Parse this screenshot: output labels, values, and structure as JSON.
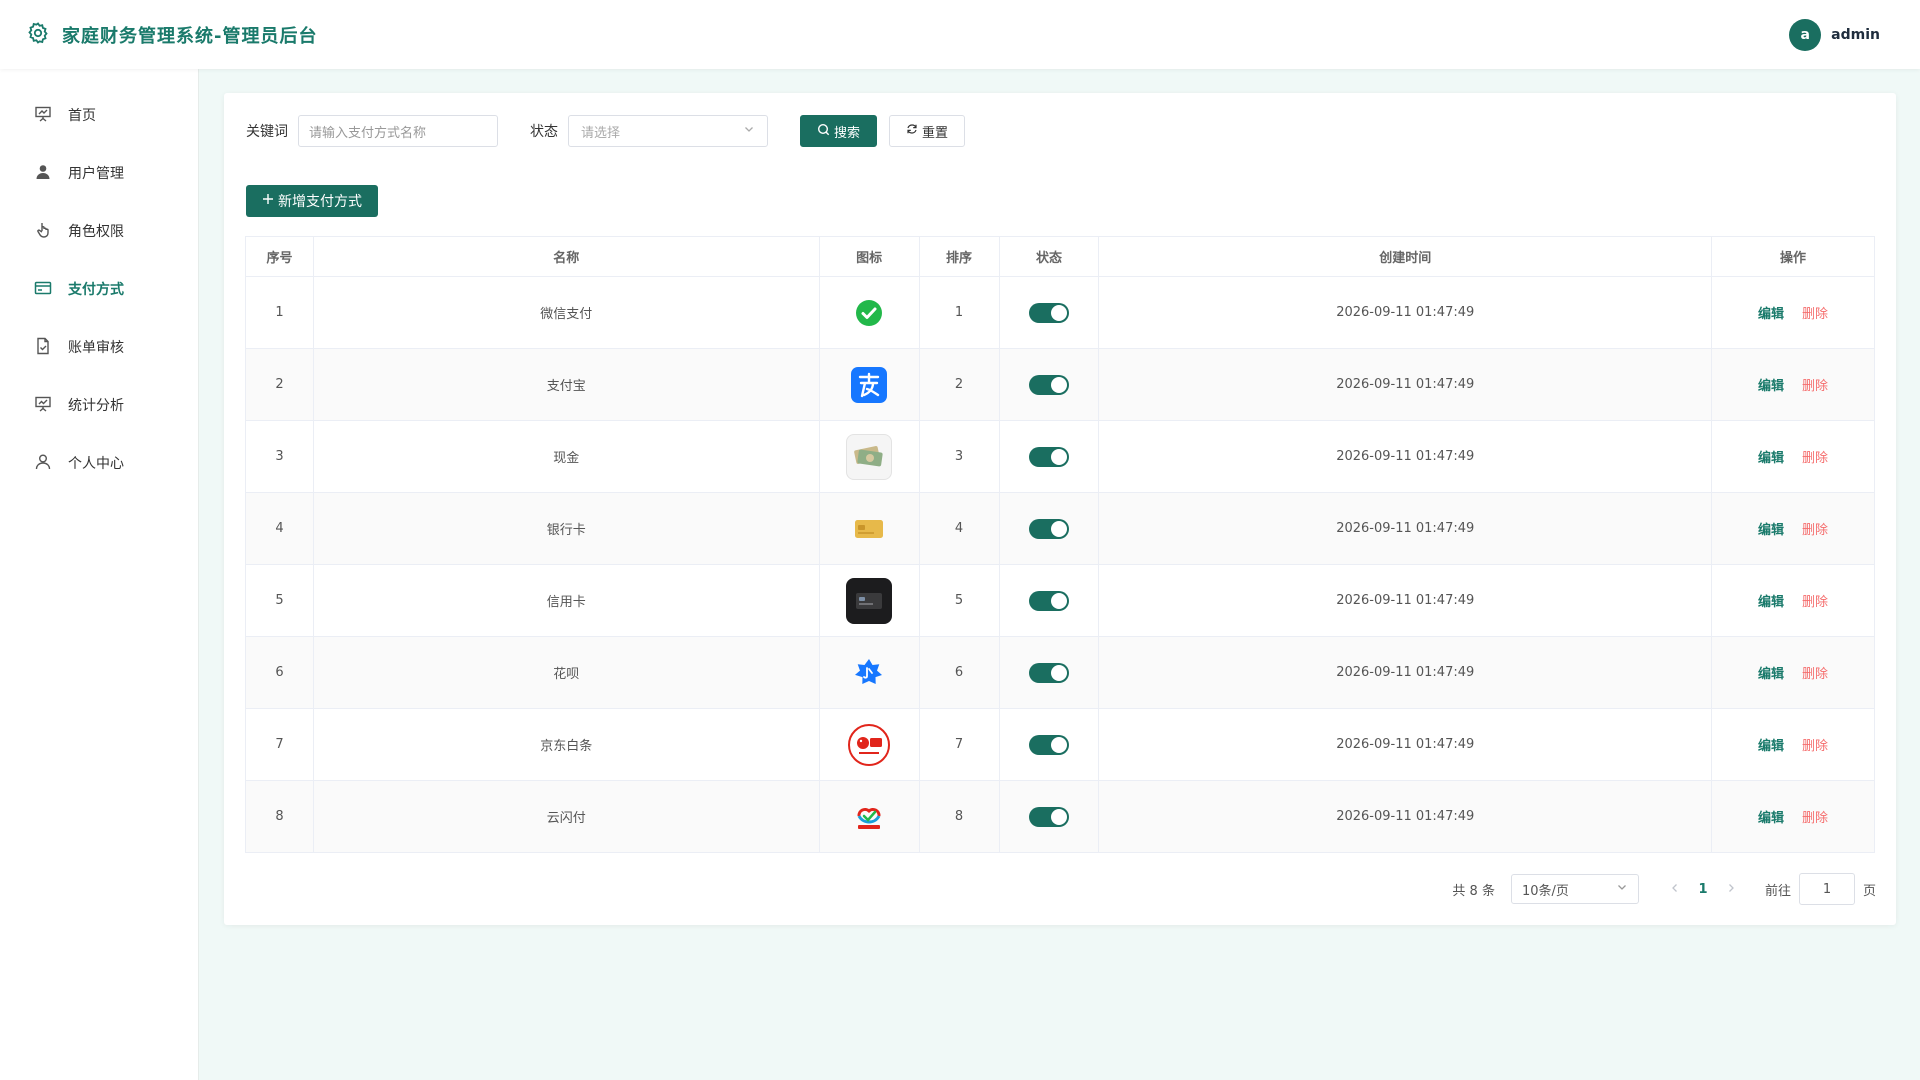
{
  "header": {
    "title": "家庭财务管理系统-管理员后台",
    "user_initial": "a",
    "username": "admin"
  },
  "sidebar": {
    "items": [
      {
        "label": "首页",
        "icon": "presentation-chart-icon",
        "active": false
      },
      {
        "label": "用户管理",
        "icon": "user-icon",
        "active": false
      },
      {
        "label": "角色权限",
        "icon": "pointer-hand-icon",
        "active": false
      },
      {
        "label": "支付方式",
        "icon": "credit-card-icon",
        "active": true
      },
      {
        "label": "账单审核",
        "icon": "document-check-icon",
        "active": false
      },
      {
        "label": "统计分析",
        "icon": "chart-board-icon",
        "active": false
      },
      {
        "label": "个人中心",
        "icon": "user-outline-icon",
        "active": false
      }
    ]
  },
  "filters": {
    "keyword_label": "关键词",
    "keyword_placeholder": "请输入支付方式名称",
    "status_label": "状态",
    "status_placeholder": "请选择",
    "search_label": "搜索",
    "reset_label": "重置"
  },
  "add_button": "新增支付方式",
  "table": {
    "columns": [
      "序号",
      "名称",
      "图标",
      "排序",
      "状态",
      "创建时间",
      "操作"
    ],
    "edit_label": "编辑",
    "delete_label": "删除",
    "rows": [
      {
        "index": "1",
        "name": "微信支付",
        "icon": "wechat-pay-icon",
        "sort": "1",
        "enabled": true,
        "created": "2026-09-11 01:47:49"
      },
      {
        "index": "2",
        "name": "支付宝",
        "icon": "alipay-icon",
        "sort": "2",
        "enabled": true,
        "created": "2026-09-11 01:47:49"
      },
      {
        "index": "3",
        "name": "现金",
        "icon": "cash-icon",
        "sort": "3",
        "enabled": true,
        "created": "2026-09-11 01:47:49"
      },
      {
        "index": "4",
        "name": "银行卡",
        "icon": "bank-card-icon",
        "sort": "4",
        "enabled": true,
        "created": "2026-09-11 01:47:49"
      },
      {
        "index": "5",
        "name": "信用卡",
        "icon": "credit-card-icon",
        "sort": "5",
        "enabled": true,
        "created": "2026-09-11 01:47:49"
      },
      {
        "index": "6",
        "name": "花呗",
        "icon": "huabei-icon",
        "sort": "6",
        "enabled": true,
        "created": "2026-09-11 01:47:49"
      },
      {
        "index": "7",
        "name": "京东白条",
        "icon": "jd-baitiao-icon",
        "sort": "7",
        "enabled": true,
        "created": "2026-09-11 01:47:49"
      },
      {
        "index": "8",
        "name": "云闪付",
        "icon": "unionpay-quickpass-icon",
        "sort": "8",
        "enabled": true,
        "created": "2026-09-11 01:47:49"
      }
    ]
  },
  "pagination": {
    "total": "共 8 条",
    "page_size": "10条/页",
    "current_page": "1",
    "goto_label": "前往",
    "goto_value": "1",
    "page_suffix": "页"
  },
  "colors": {
    "primary": "#1a6e60",
    "title": "#1a7a6b",
    "danger": "#f56c6c",
    "background": "#f0f9f7"
  }
}
